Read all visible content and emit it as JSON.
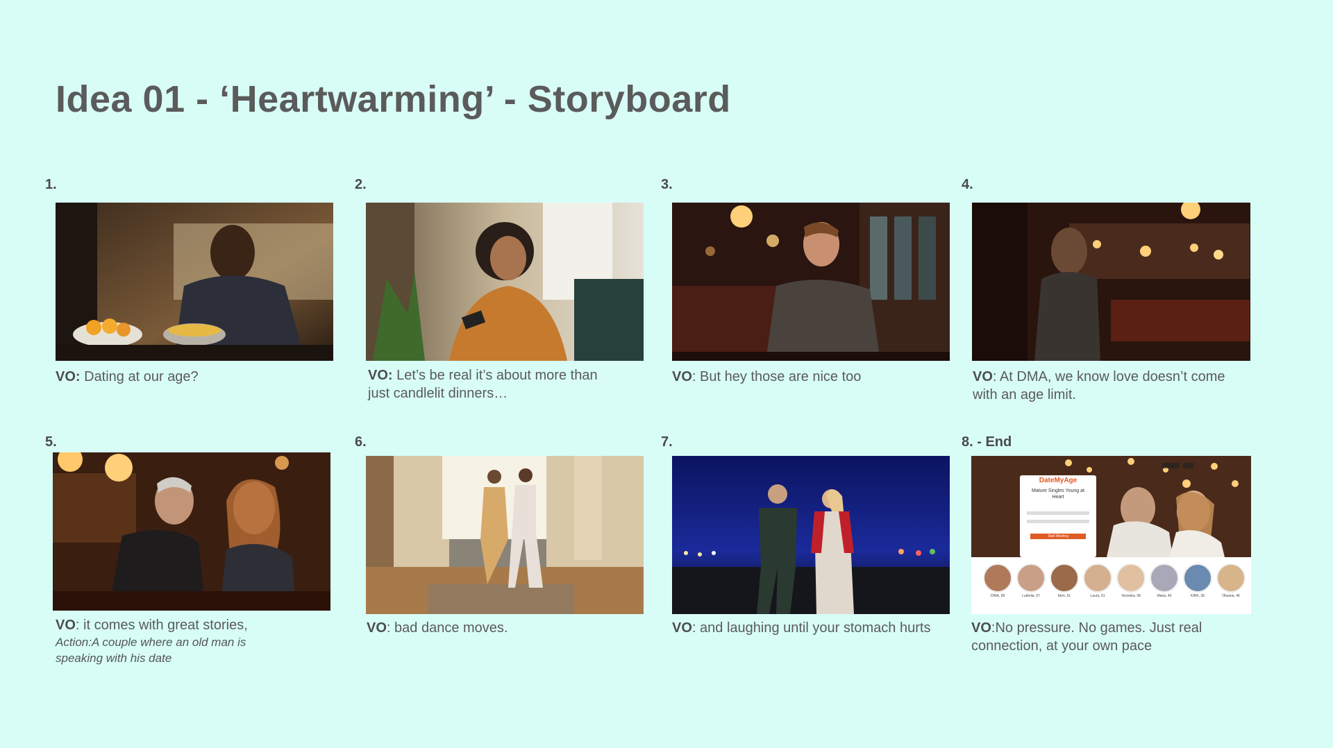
{
  "title": "Idea 01 - ‘Heartwarming’ - Storyboard",
  "panels": [
    {
      "number": "1.",
      "vo_label": "VO:",
      "text": " Dating at our age?",
      "scene": "older man cooking in warm kitchen"
    },
    {
      "number": "2.",
      "vo_label": "VO:",
      "text": " Let’s be real it’s about more than just candlelit dinners…",
      "scene": "woman smiling at phone in living room"
    },
    {
      "number": "3.",
      "vo_label": "VO",
      "text": ": But hey those are nice too",
      "scene": "man waiting in restaurant booth"
    },
    {
      "number": "4.",
      "vo_label": "VO",
      "text": ": At DMA, we know love doesn’t come with an age limit.",
      "scene": "woman walking into restaurant"
    },
    {
      "number": "5.",
      "vo_label": "VO",
      "text": ": it comes with great stories,",
      "action": "Action:A couple where an old man is speaking with his date",
      "scene": "older couple holding hands at bar"
    },
    {
      "number": "6.",
      "vo_label": "VO",
      "text": ": bad dance moves.",
      "scene": "couple dancing in sunny living room"
    },
    {
      "number": "7.",
      "vo_label": "VO",
      "text": ": and laughing until your stomach hurts",
      "scene": "couple walking at night holding hands"
    },
    {
      "number": "8. - End",
      "vo_label": "VO",
      "text": ":No pressure. No games. Just real connection, at your own pace",
      "scene": "DateMyAge website screen"
    }
  ],
  "website": {
    "logo": "DateMyAge",
    "headline": "Mature Singles Young at Heart",
    "button": "Start Meeting",
    "profiles": [
      "DINA, 58",
      "Ludmila, 57",
      "Elen, 51",
      "Laura, 61",
      "Veronika, 58",
      "Maria, 40",
      "KIRK, 36",
      "Oksana, 46"
    ]
  }
}
